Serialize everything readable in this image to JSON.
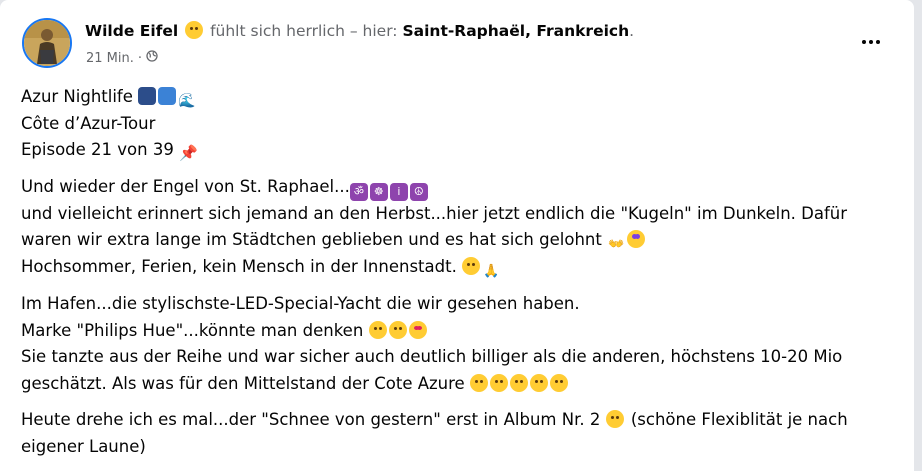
{
  "post": {
    "author": "Wilde Eifel",
    "author_emoji": "slightly-smiling-face-icon",
    "feeling_text": "fühlt sich herrlich – hier:",
    "location": "Saint-Raphaël, Frankreich",
    "location_suffix": ".",
    "timestamp": "21 Min.",
    "separator": "·",
    "privacy_icon": "globe-icon",
    "more_icon": "more-options-icon"
  },
  "text": {
    "p1_l1": "Azur Nightlife",
    "p1_l2": "Côte d’Azur-Tour",
    "p1_l3": "Episode 21 von 39",
    "p2_l1": "Und wieder der Engel von St. Raphael...",
    "p2_l2": "und vielleicht erinnert sich jemand an den Herbst...hier jetzt endlich die \"Kugeln\" im Dunkeln. Dafür",
    "p2_l3": "waren wir extra lange im Städtchen geblieben und es hat sich gelohnt",
    "p2_l4": "Hochsommer, Ferien, kein Mensch in der Innenstadt.",
    "p3_l1": "Im Hafen...die stylischste-LED-Special-Yacht die wir gesehen haben.",
    "p3_l2": "Marke \"Philips Hue\"...könnte man denken",
    "p3_l3": "Sie tanzte aus der Reihe und war sicher auch deutlich billiger als die anderen, höchstens 10-20 Mio",
    "p3_l4": "geschätzt. Als was für den Mittelstand der Cote Azure",
    "p4_l1a": "Heute drehe ich es mal...der \"Schnee von gestern\" erst in Album Nr. 2",
    "p4_l1b": "(schöne Flexiblität je nach",
    "p4_l2": "eigener Laune)"
  },
  "colors": {
    "accent": "#1877f2",
    "text": "#050505",
    "secondary_text": "#65676b"
  }
}
